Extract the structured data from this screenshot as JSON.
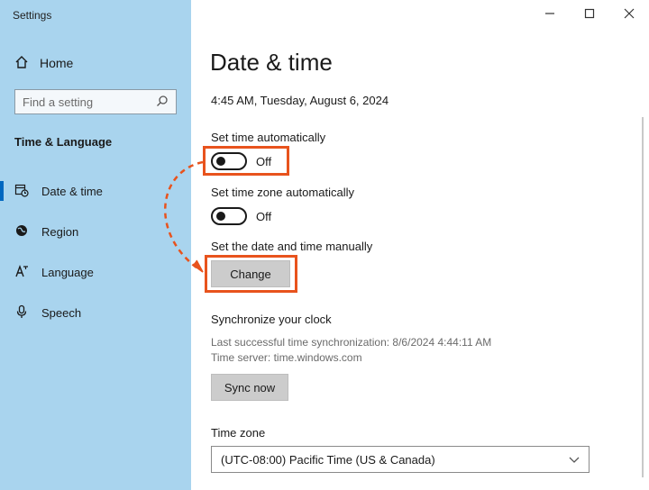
{
  "window": {
    "title": "Settings"
  },
  "sidebar": {
    "home_label": "Home",
    "search_placeholder": "Find a setting",
    "section_title": "Time & Language",
    "items": [
      {
        "label": "Date & time",
        "icon": "calendar-clock-icon",
        "active": true
      },
      {
        "label": "Region",
        "icon": "globe-icon",
        "active": false
      },
      {
        "label": "Language",
        "icon": "language-icon",
        "active": false
      },
      {
        "label": "Speech",
        "icon": "microphone-icon",
        "active": false
      }
    ]
  },
  "main": {
    "title": "Date & time",
    "current_datetime": "4:45 AM, Tuesday, August 6, 2024",
    "set_time_auto": {
      "label": "Set time automatically",
      "state": "Off"
    },
    "set_timezone_auto": {
      "label": "Set time zone automatically",
      "state": "Off"
    },
    "manual": {
      "label": "Set the date and time manually",
      "button": "Change"
    },
    "sync": {
      "heading": "Synchronize your clock",
      "last_sync": "Last successful time synchronization: 8/6/2024 4:44:11 AM",
      "server": "Time server: time.windows.com",
      "button": "Sync now"
    },
    "timezone": {
      "label": "Time zone",
      "value": "(UTC-08:00) Pacific Time (US & Canada)"
    }
  },
  "colors": {
    "sidebar_bg": "#a9d4ee",
    "highlight": "#e8531d",
    "accent": "#0067c0"
  }
}
